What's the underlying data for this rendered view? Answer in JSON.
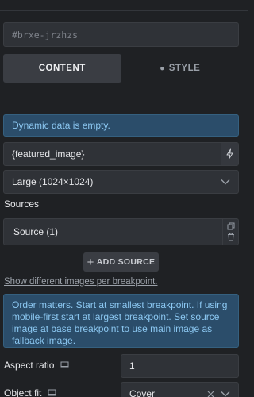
{
  "element_id": {
    "value": "#brxe-jrzhzs"
  },
  "tabs": [
    {
      "label": "CONTENT",
      "active": true
    },
    {
      "label": "STYLE",
      "active": false
    }
  ],
  "notices": {
    "dynamic_empty": "Dynamic data is empty.",
    "order_matters": "Order matters. Start at smallest breakpoint. If using mobile-first start at largest breakpoint. Set source image at base breakpoint to use main image as fallback image."
  },
  "image": {
    "dynamic_value": "{featured_image}",
    "size_value": "Large (1024×1024)"
  },
  "sources": {
    "label": "Sources",
    "items": [
      {
        "label": "Source (1)"
      }
    ],
    "add_label": "ADD SOURCE",
    "per_breakpoint_link": "Show different images per breakpoint."
  },
  "aspect_ratio": {
    "label": "Aspect ratio",
    "value": "1"
  },
  "object_fit": {
    "label": "Object fit",
    "value": "Cover"
  },
  "icons": {
    "dynamic": "bolt-icon",
    "dropdown": "chevron-down-icon",
    "duplicate": "duplicate-icon",
    "delete": "trash-icon",
    "responsive": "desktop-icon",
    "clear": "close-icon"
  },
  "colors": {
    "background": "#1f2124",
    "field": "#2f3237",
    "info_bg": "#2b4d6a",
    "info_text": "#8cc8f2"
  }
}
